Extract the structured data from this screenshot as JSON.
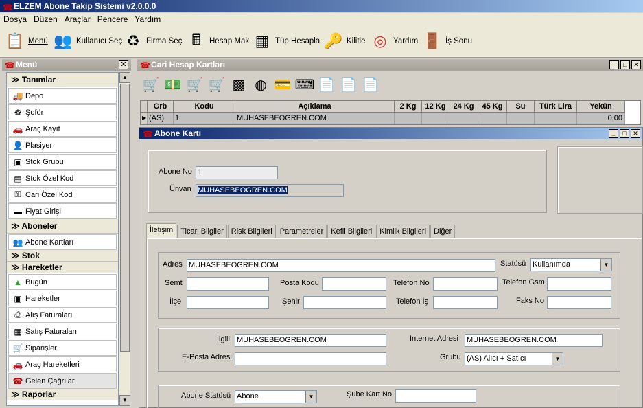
{
  "app": {
    "title": "ELZEM Abone Takip Sistemi v2.0.0.0"
  },
  "menubar": [
    "Dosya",
    "Düzen",
    "Araçlar",
    "Pencere",
    "Yardım"
  ],
  "toolbar": [
    {
      "label": "Menü",
      "icon": "menu-icon"
    },
    {
      "label": "Kullanıcı Seç",
      "icon": "users-icon"
    },
    {
      "label": "Firma Seç",
      "icon": "recycle-bin-icon"
    },
    {
      "label": "Hesap Mak",
      "icon": "calculator-icon"
    },
    {
      "label": "Tüp Hesapla",
      "icon": "calculator-dark-icon"
    },
    {
      "label": "Kilitle",
      "icon": "person-key-icon"
    },
    {
      "label": "Yardım",
      "icon": "lifebuoy-icon"
    },
    {
      "label": "İş Sonu",
      "icon": "exit-door-icon"
    }
  ],
  "sidebar": {
    "title": "Menü",
    "groups": [
      {
        "label": "Tanımlar",
        "items": [
          {
            "label": "Depo",
            "icon": "truck-icon"
          },
          {
            "label": "Şoför",
            "icon": "steering-wheel-icon"
          },
          {
            "label": "Araç Kayıt",
            "icon": "car-icon"
          },
          {
            "label": "Plasiyer",
            "icon": "person-icon"
          },
          {
            "label": "Stok Grubu",
            "icon": "boxes-icon"
          },
          {
            "label": "Stok Özel Kod",
            "icon": "stock-code-icon"
          },
          {
            "label": "Cari Özel Kod",
            "icon": "key-icon"
          },
          {
            "label": "Fiyat Girişi",
            "icon": "price-icon"
          }
        ]
      },
      {
        "label": "Aboneler",
        "items": [
          {
            "label": "Abone Kartları",
            "icon": "people-icon"
          }
        ]
      },
      {
        "label": "Stok",
        "items": []
      },
      {
        "label": "Hareketler",
        "items": [
          {
            "label": "Bugün",
            "icon": "chart-icon"
          },
          {
            "label": "Hareketler",
            "icon": "boxes-icon"
          },
          {
            "label": "Alış Faturaları",
            "icon": "printer-icon"
          },
          {
            "label": "Satış Faturaları",
            "icon": "invoice-icon"
          },
          {
            "label": "Siparişler",
            "icon": "cart-icon"
          },
          {
            "label": "Araç Hareketleri",
            "icon": "car-icon"
          },
          {
            "label": "Gelen Çağrılar",
            "icon": "phone-icon"
          }
        ]
      },
      {
        "label": "Raporlar",
        "items": []
      }
    ]
  },
  "cari": {
    "title": "Cari Hesap Kartları",
    "columns": [
      "Grb",
      "Kodu",
      "Açıklama",
      "2 Kg",
      "12 Kg",
      "24 Kg",
      "45 Kg",
      "Su",
      "Türk Lira",
      "Yekün"
    ],
    "row": [
      "(AS)",
      "1",
      "MUHASEBEOGREN.COM",
      "",
      "",
      "",
      "",
      "",
      "",
      "0,00"
    ]
  },
  "abone": {
    "title": "Abone Kartı",
    "abone_no_label": "Abone No",
    "abone_no": "1",
    "unvan_label": "Ünvan",
    "unvan": "MUHASEBEOGREN.COM",
    "tabs": [
      "İletişim",
      "Ticari Bilgiler",
      "Risk Bilgileri",
      "Parametreler",
      "Kefil Bilgileri",
      "Kimlik Bilgileri",
      "Diğer"
    ],
    "adres_label": "Adres",
    "adres": "MUHASEBEOGREN.COM",
    "statusu_label": "Statüsü",
    "statusu": "Kullanımda",
    "semt_label": "Semt",
    "semt": "",
    "posta_kodu_label": "Posta Kodu",
    "posta_kodu": "",
    "telefon_no_label": "Telefon No",
    "telefon_no": "",
    "telefon_gsm_label": "Telefon Gsm",
    "telefon_gsm": "",
    "ilce_label": "İlçe",
    "ilce": "",
    "sehir_label": "Şehir",
    "sehir": "",
    "telefon_is_label": "Telefon İş",
    "telefon_is": "",
    "faks_no_label": "Faks No",
    "faks_no": "",
    "ilgili_label": "İlgili",
    "ilgili": "MUHASEBEOGREN.COM",
    "internet_label": "Internet Adresi",
    "internet": "MUHASEBEOGREN.COM",
    "eposta_label": "E-Posta Adresi",
    "eposta": "",
    "grubu_label": "Grubu",
    "grubu": "(AS) Alıcı + Satıcı",
    "abone_statusu_label": "Abone Statüsü",
    "abone_statusu": "Abone",
    "sube_kart_no_label": "Şube Kart No",
    "sube_kart_no": ""
  }
}
